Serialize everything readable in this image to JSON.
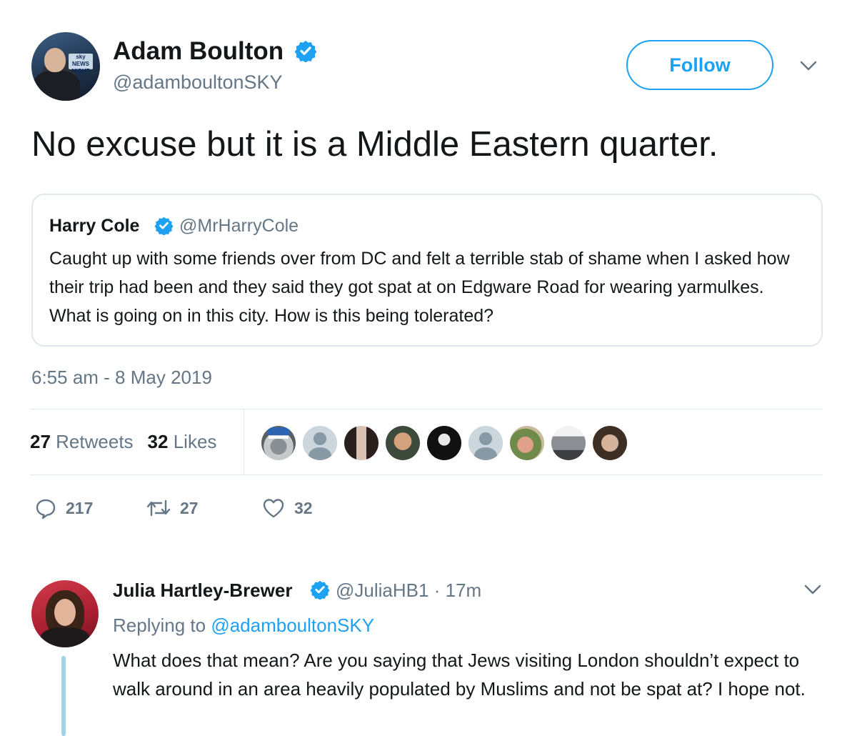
{
  "tweet": {
    "author_name": "Adam Boulton",
    "author_handle": "@adamboultonSKY",
    "avatar_logo_text": "sky NEWS NIGHT",
    "follow_label": "Follow",
    "text": "No excuse but it is a Middle Eastern quarter.",
    "quoted": {
      "author_name": "Harry Cole",
      "author_handle": "@MrHarryCole",
      "text": "Caught up with some friends over from DC and felt a terrible stab of shame when I asked how their trip had been and they said they got spat at on Edgware Road for wearing yarmulkes. What is going on in this city. How is this being tolerated?"
    },
    "timestamp": "6:55 am - 8 May 2019",
    "stats": {
      "retweets_count": "27",
      "retweets_label": "Retweets",
      "likes_count": "32",
      "likes_label": "Likes"
    },
    "actions": {
      "reply_count": "217",
      "retweet_count": "27",
      "like_count": "32"
    }
  },
  "likers": [
    "liker-1",
    "liker-2",
    "liker-3",
    "liker-4",
    "liker-5",
    "liker-6",
    "liker-7",
    "liker-8",
    "liker-9"
  ],
  "reply": {
    "author_name": "Julia Hartley-Brewer",
    "author_handle": "@JuliaHB1",
    "separator": "·",
    "time_ago": "17m",
    "replying_prefix": "Replying to",
    "replying_to": "@adamboultonSKY",
    "text": "What does that mean? Are you saying that Jews visiting London shouldn’t expect to walk around in an area heavily populated by Muslims and not be spat at? I hope not."
  },
  "colors": {
    "accent": "#1da1f2",
    "secondary_text": "#657786",
    "primary_text": "#14171a",
    "border": "#e1e8ed"
  }
}
